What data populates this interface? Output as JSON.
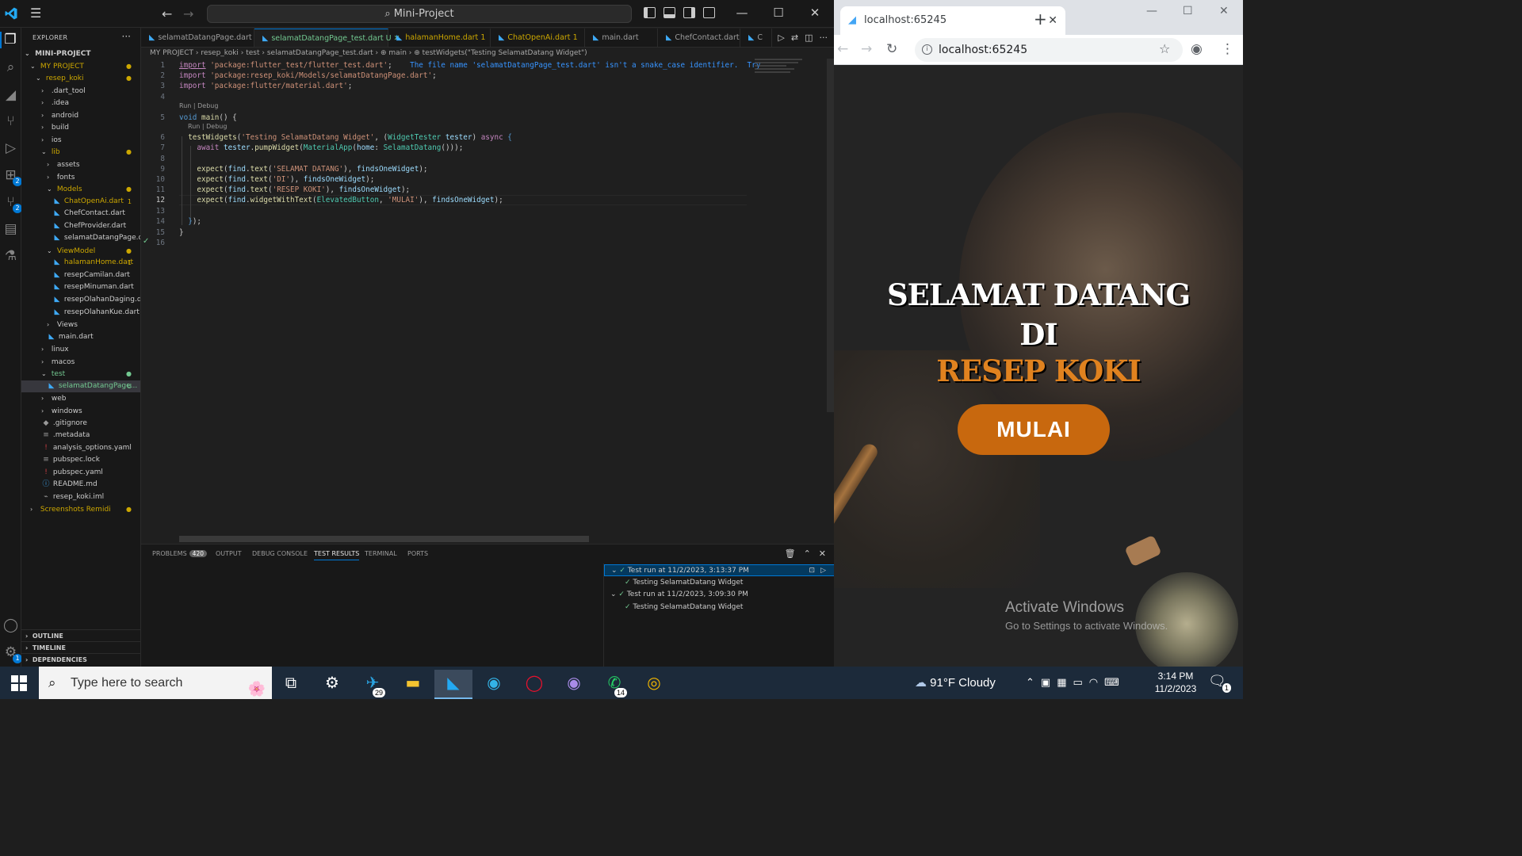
{
  "vscode": {
    "command_center": "Mini-Project",
    "explorer_title": "EXPLORER",
    "tree": [
      {
        "label": "MINI-PROJECT",
        "depth": 0,
        "kind": "root",
        "chev": "⌄"
      },
      {
        "label": "MY PROJECT",
        "depth": 1,
        "kind": "folder",
        "chev": "⌄",
        "state": "warn",
        "marker": "●"
      },
      {
        "label": "resep_koki",
        "depth": 2,
        "kind": "folder",
        "chev": "⌄",
        "state": "warn",
        "marker": "●"
      },
      {
        "label": ".dart_tool",
        "depth": 3,
        "kind": "folder",
        "chev": "›"
      },
      {
        "label": ".idea",
        "depth": 3,
        "kind": "folder",
        "chev": "›"
      },
      {
        "label": "android",
        "depth": 3,
        "kind": "folder",
        "chev": "›"
      },
      {
        "label": "build",
        "depth": 3,
        "kind": "folder",
        "chev": "›"
      },
      {
        "label": "ios",
        "depth": 3,
        "kind": "folder",
        "chev": "›"
      },
      {
        "label": "lib",
        "depth": 3,
        "kind": "folder",
        "chev": "⌄",
        "state": "warn",
        "marker": "●"
      },
      {
        "label": "assets",
        "depth": 4,
        "kind": "folder",
        "chev": "›"
      },
      {
        "label": "fonts",
        "depth": 4,
        "kind": "folder",
        "chev": "›"
      },
      {
        "label": "Models",
        "depth": 4,
        "kind": "folder",
        "chev": "⌄",
        "state": "warn",
        "marker": "●"
      },
      {
        "label": "ChatOpenAi.dart",
        "depth": 5,
        "kind": "file",
        "state": "warn",
        "marker": "1"
      },
      {
        "label": "ChefContact.dart",
        "depth": 5,
        "kind": "file"
      },
      {
        "label": "ChefProvider.dart",
        "depth": 5,
        "kind": "file"
      },
      {
        "label": "selamatDatangPage.dart",
        "depth": 5,
        "kind": "file"
      },
      {
        "label": "ViewModel",
        "depth": 4,
        "kind": "folder",
        "chev": "⌄",
        "state": "warn",
        "marker": "●"
      },
      {
        "label": "halamanHome.dart",
        "depth": 5,
        "kind": "file",
        "state": "warn",
        "marker": "1"
      },
      {
        "label": "resepCamilan.dart",
        "depth": 5,
        "kind": "file"
      },
      {
        "label": "resepMinuman.dart",
        "depth": 5,
        "kind": "file"
      },
      {
        "label": "resepOlahanDaging.dart",
        "depth": 5,
        "kind": "file"
      },
      {
        "label": "resepOlahanKue.dart",
        "depth": 5,
        "kind": "file"
      },
      {
        "label": "Views",
        "depth": 4,
        "kind": "folder",
        "chev": "›"
      },
      {
        "label": "main.dart",
        "depth": 4,
        "kind": "file"
      },
      {
        "label": "linux",
        "depth": 3,
        "kind": "folder",
        "chev": "›"
      },
      {
        "label": "macos",
        "depth": 3,
        "kind": "folder",
        "chev": "›"
      },
      {
        "label": "test",
        "depth": 3,
        "kind": "folder",
        "chev": "⌄",
        "state": "git",
        "marker": "●"
      },
      {
        "label": "selamatDatangPage...",
        "depth": 4,
        "kind": "file",
        "state": "git",
        "marker": "U",
        "selected": true
      },
      {
        "label": "web",
        "depth": 3,
        "kind": "folder",
        "chev": "›"
      },
      {
        "label": "windows",
        "depth": 3,
        "kind": "folder",
        "chev": "›"
      },
      {
        "label": ".gitignore",
        "depth": 3,
        "kind": "misc",
        "icon": "◆"
      },
      {
        "label": ".metadata",
        "depth": 3,
        "kind": "misc",
        "icon": "≡"
      },
      {
        "label": "analysis_options.yaml",
        "depth": 3,
        "kind": "misc",
        "icon": "!"
      },
      {
        "label": "pubspec.lock",
        "depth": 3,
        "kind": "misc",
        "icon": "≡"
      },
      {
        "label": "pubspec.yaml",
        "depth": 3,
        "kind": "misc",
        "icon": "!"
      },
      {
        "label": "README.md",
        "depth": 3,
        "kind": "misc",
        "icon": "ⓘ"
      },
      {
        "label": "resep_koki.iml",
        "depth": 3,
        "kind": "misc",
        "icon": "⌁"
      },
      {
        "label": "Screenshots Remidi",
        "depth": 1,
        "kind": "folder",
        "chev": "›",
        "state": "warn",
        "marker": "●"
      }
    ],
    "sections": [
      "OUTLINE",
      "TIMELINE",
      "DEPENDENCIES"
    ],
    "tabs": [
      {
        "label": "selamatDatangPage.dart",
        "state": "",
        "suffix": ""
      },
      {
        "label": "selamatDatangPage_test.dart",
        "state": "active",
        "suffix": "U  ✕"
      },
      {
        "label": "halamanHome.dart",
        "state": "warn",
        "suffix": "1"
      },
      {
        "label": "ChatOpenAi.dart",
        "state": "warn",
        "suffix": "1"
      },
      {
        "label": "main.dart",
        "state": "",
        "suffix": ""
      },
      {
        "label": "ChefContact.dart",
        "state": "",
        "suffix": ""
      },
      {
        "label": "C",
        "state": "",
        "suffix": ""
      }
    ],
    "breadcrumb": "MY PROJECT › resep_koki › test › selamatDatangPage_test.dart › ⊕ main › ⊕ testWidgets(\"Testing SelamatDatang Widget\")",
    "codelens": "Run | Debug",
    "diagnostic": "The file name 'selamatDatangPage_test.dart' isn't a snake_case identifier.",
    "diagnostic_more": "Try",
    "code": {
      "l1": "'package:flutter_test/flutter_test.dart'",
      "l2": "'package:resep_koki/Models/selamatDatangPage.dart'",
      "l3": "'package:flutter/material.dart'",
      "l6_str": "'Testing SelamatDatang Widget'",
      "l9_str": "'SELAMAT DATANG'",
      "l10_str": "'DI'",
      "l11_str": "'RESEP KOKI'",
      "l12_str": "'MULAI'"
    },
    "panel_tabs": [
      {
        "label": "PROBLEMS",
        "badge": "420"
      },
      {
        "label": "OUTPUT"
      },
      {
        "label": "DEBUG CONSOLE"
      },
      {
        "label": "TEST RESULTS",
        "active": true
      },
      {
        "label": "TERMINAL"
      },
      {
        "label": "PORTS"
      }
    ],
    "results": [
      {
        "label": "Test run at 11/2/2023, 3:13:37 PM",
        "level": 0,
        "selected": true
      },
      {
        "label": "Testing SelamatDatang Widget",
        "level": 1
      },
      {
        "label": "Test run at 11/2/2023, 3:09:30 PM",
        "level": 0
      },
      {
        "label": "Testing SelamatDatang Widget",
        "level": 1
      }
    ],
    "activity_badges": [
      "2",
      "2",
      "1"
    ]
  },
  "chrome": {
    "tab_title": "localhost:65245",
    "address": "localhost:65245",
    "app": {
      "line1": "SELAMAT DATANG",
      "line2": "DI",
      "line3": "RESEP KOKI",
      "button": "MULAI"
    },
    "watermark_title": "Activate Windows",
    "watermark_sub": "Go to Settings to activate Windows."
  },
  "taskbar": {
    "search_placeholder": "Type here to search",
    "telegram_badge": "29",
    "whatsapp_badge": "14",
    "weather": "91°F  Cloudy",
    "time": "3:14 PM",
    "date": "11/2/2023",
    "notifications": "1"
  },
  "colors": {
    "accent": "#0078d4",
    "git_untracked": "#73c991",
    "warning": "#cca700",
    "app_orange": "#e0821f",
    "mulai_button": "#c8680e"
  }
}
